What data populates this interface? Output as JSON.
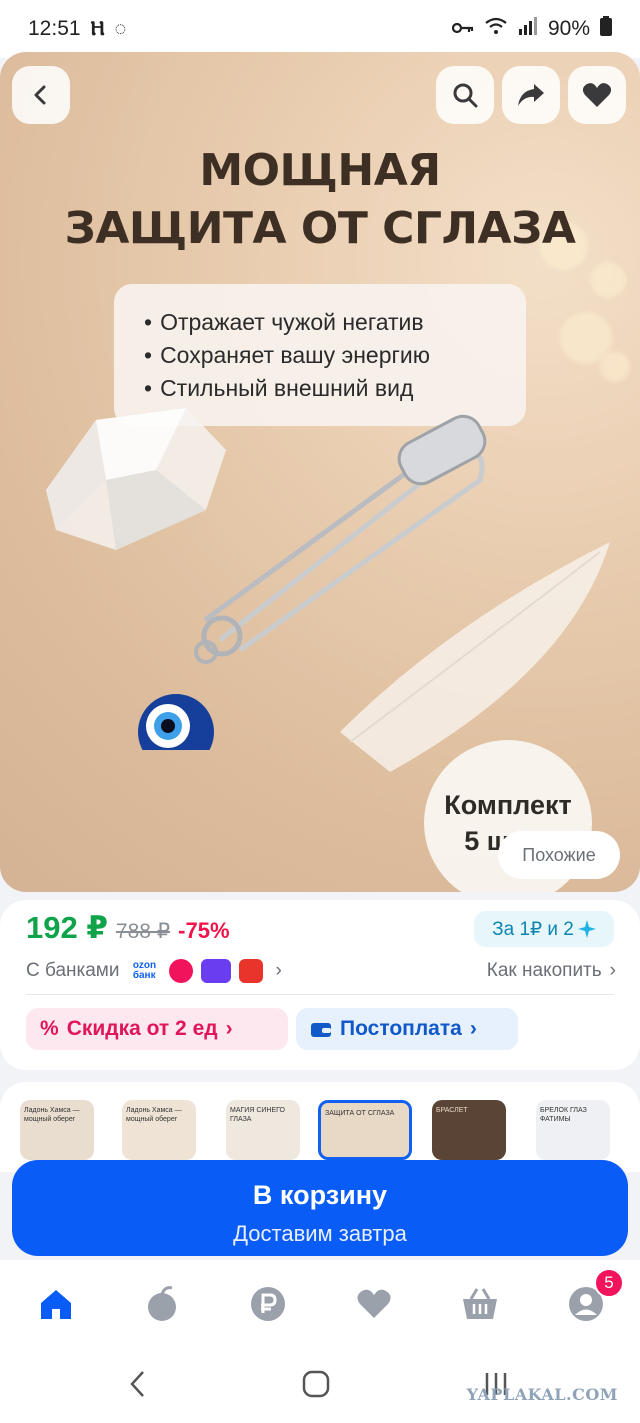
{
  "status_bar": {
    "time": "12:51",
    "battery": "90%",
    "icons": [
      "key-icon",
      "wifi-icon",
      "signal-icon",
      "battery-icon"
    ]
  },
  "hero": {
    "title_line1": "МОЩНАЯ",
    "title_line2": "ЗАЩИТА ОТ СГЛАЗА",
    "features": [
      "Отражает чужой негатив",
      "Сохраняет вашу энергию",
      "Стильный внешний вид"
    ],
    "badge_line1": "Комплект",
    "badge_line2": "5 штук",
    "similar_label": "Похожие",
    "buttons": [
      "back-icon",
      "search-icon",
      "share-icon",
      "heart-icon"
    ]
  },
  "price": {
    "current": "192 ₽",
    "old": "788 ₽",
    "discount": "-75%",
    "earn_label": "За 1₽ и 2",
    "banks_label": "С банками",
    "banks": [
      {
        "name": "ozon банк",
        "color": "#1160f0"
      },
      {
        "name": "",
        "color": "#f2135d"
      },
      {
        "name": "",
        "color": "#6b3df0"
      },
      {
        "name": "",
        "color": "#e8342a"
      }
    ],
    "save_link": "Как накопить"
  },
  "promos": {
    "discount_label": "Скидка от 2 ед",
    "postpay_label": "Постоплата"
  },
  "thumbnails": [
    {
      "caption": "Ладонь Хамса — мощный оберег",
      "bg": "#e9ddd0"
    },
    {
      "caption": "Ладонь Хамса — мощный оберег",
      "bg": "#efe3d6"
    },
    {
      "caption": "МАГИЯ СИНЕГО ГЛАЗА",
      "bg": "#efe8df"
    },
    {
      "caption": "ЗАЩИТА ОТ СГЛАЗА",
      "bg": "#e8d9c7"
    },
    {
      "caption": "БРАСЛЕТ",
      "bg": "#5a4436"
    },
    {
      "caption": "БРЕЛОК ГЛАЗ ФАТИМЫ",
      "bg": "#eef0f3"
    }
  ],
  "cart": {
    "label": "В корзину",
    "sublabel": "Доставим завтра"
  },
  "bottom_nav": {
    "items": [
      "home-icon",
      "fresh-icon",
      "ruble-icon",
      "favorites-icon",
      "cart-icon",
      "profile-icon"
    ],
    "profile_badge": "5",
    "active_color": "#0a5cf6",
    "inactive_color": "#9aa1ab"
  },
  "watermark": "YAPLAKAL.COM"
}
